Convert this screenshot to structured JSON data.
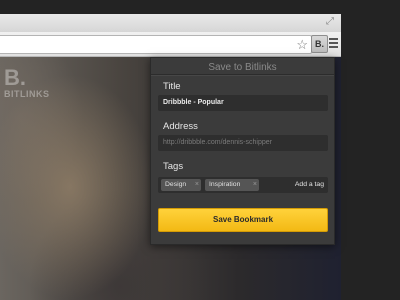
{
  "toolbar": {
    "extension_button_label": "B.",
    "bookmark_icon": "star-icon",
    "menu_icon": "hamburger-menu-icon"
  },
  "page": {
    "logo": "B.",
    "brand_name": "BITLINKS"
  },
  "popup": {
    "title": "Save to Bitlinks",
    "title_label": "Title",
    "title_value": "Dribbble - Popular",
    "address_label": "Address",
    "address_value": "http://dribbble.com/dennis-schipper",
    "tags_label": "Tags",
    "tags": [
      {
        "label": "Design",
        "remove": "×"
      },
      {
        "label": "Inspiration",
        "remove": "×"
      }
    ],
    "add_tag_label": "Add a tag",
    "save_label": "Save Bookmark"
  },
  "colors": {
    "accent": "#f7c325",
    "panel": "#3b3b3b"
  }
}
